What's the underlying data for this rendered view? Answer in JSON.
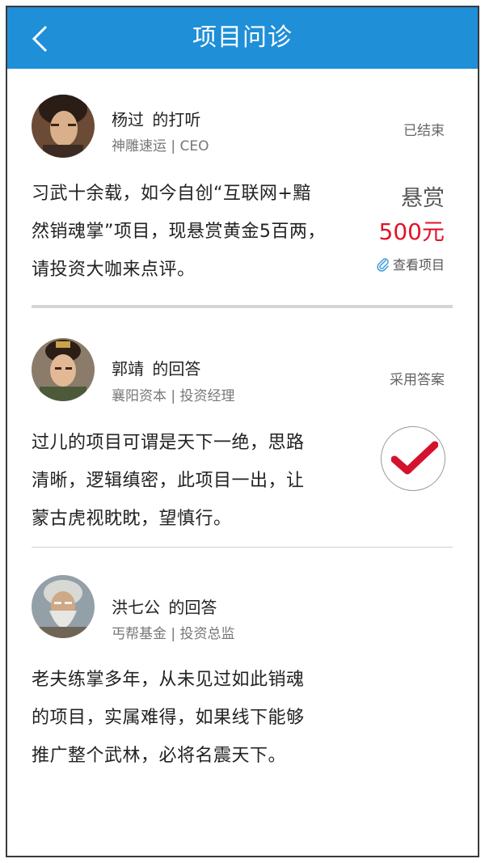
{
  "header": {
    "title": "项目问诊"
  },
  "post": {
    "author": "杨过",
    "action": "的打听",
    "org": "神雕速运 | CEO",
    "status": "已结束",
    "content": [
      "习武十余载，如今自创“互联网+黯",
      "然销魂掌”项目，现悬赏黄金5百两，",
      "请投资大咖来点评。"
    ],
    "reward_label": "悬赏",
    "reward_amount": "500元",
    "view_project": "查看项目"
  },
  "answers": [
    {
      "author": "郭靖",
      "action": "的回答",
      "org": "襄阳资本 | 投资经理",
      "status": "采用答案",
      "content": [
        "过儿的项目可谓是天下一绝，思路",
        "清晰，逻辑缜密，此项目一出，让",
        "蒙古虎视眈眈，望慎行。"
      ]
    },
    {
      "author": "洪七公",
      "action": "的回答",
      "org": "丐帮基金 | 投资总监",
      "content": [
        "老夫练掌多年，从未见过如此销魂",
        "的项目，实属难得，如果线下能够",
        "推广整个武林，必将名震天下。"
      ]
    }
  ],
  "colors": {
    "header_bg": "#1f8fd8",
    "reward": "#e0142a",
    "check": "#d4122d"
  }
}
